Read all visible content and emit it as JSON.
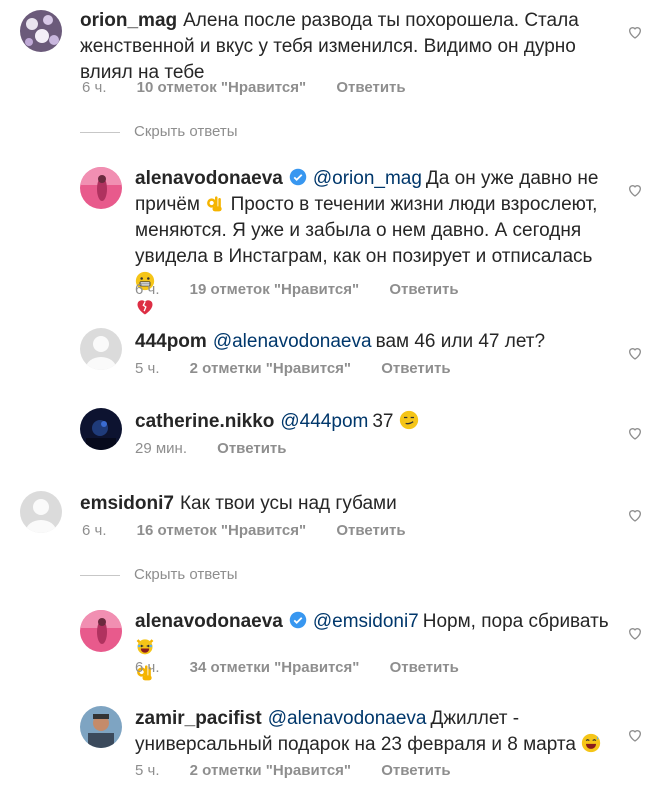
{
  "comments": [
    {
      "username": "orion_mag",
      "text": "Алена после развода ты похорошела. Стала женственной и вкус у тебя изменился. Видимо он дурно влиял на тебе",
      "time": "6 ч.",
      "likes": "10 отметок \"Нравится\"",
      "reply": "Ответить",
      "hide_replies": "Скрыть ответы"
    },
    {
      "username": "alenavodonaeva",
      "mention": "@orion_mag",
      "text": "Да он уже давно не причём",
      "text2": "Просто в течении жизни люди взрослеют, меняются. Я уже и забыла о нем давно. А сегодня увидела в Инстаграм, как он позирует и отписалась",
      "time": "6 ч.",
      "likes": "19 отметок \"Нравится\"",
      "reply": "Ответить"
    },
    {
      "username": "444pom",
      "mention": "@alenavodonaeva",
      "text": "вам 46 или 47 лет?",
      "time": "5 ч.",
      "likes": "2 отметки \"Нравится\"",
      "reply": "Ответить"
    },
    {
      "username": "catherine.nikko",
      "mention": "@444pom",
      "text": "37",
      "time": "29 мин.",
      "reply": "Ответить"
    },
    {
      "username": "emsidoni7",
      "text": "Как твои усы над губами",
      "time": "6 ч.",
      "likes": "16 отметок \"Нравится\"",
      "reply": "Ответить",
      "hide_replies": "Скрыть ответы"
    },
    {
      "username": "alenavodonaeva",
      "mention": "@emsidoni7",
      "text": "Норм, пора сбривать",
      "time": "6 ч.",
      "likes": "34 отметки \"Нравится\"",
      "reply": "Ответить"
    },
    {
      "username": "zamir_pacifist",
      "mention": "@alenavodonaeva",
      "text": "Джиллет - универсальный подарок на 23 февраля и 8 марта",
      "time": "5 ч.",
      "likes": "2 отметки \"Нравится\"",
      "reply": "Ответить"
    }
  ],
  "icons": {
    "heart": "heart-outline-icon",
    "verified": "verified-badge-icon"
  },
  "colors": {
    "text": "#262626",
    "meta": "#8e8e8e",
    "mention": "#00376b",
    "verified": "#3897f0"
  }
}
